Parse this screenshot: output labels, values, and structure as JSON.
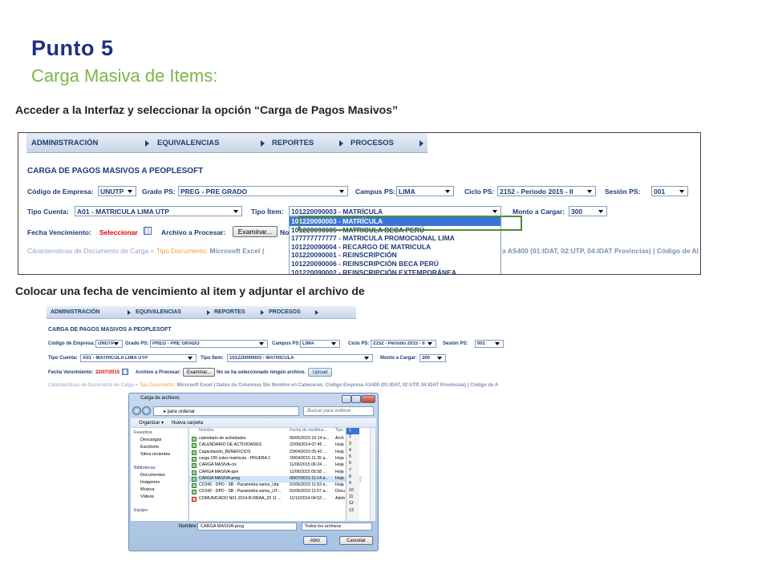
{
  "slide": {
    "title": "Punto 5",
    "subtitle": "Carga Masiva de Items:",
    "instruction_1": "Acceder a la Interfaz y seleccionar la opción “Carga de Pagos Masivos”",
    "instruction_2": "Colocar una fecha de vencimiento al item y adjuntar el archivo de"
  },
  "app": {
    "menu": [
      "ADMINISTRACIÓN",
      "EQUIVALENCIAS",
      "REPORTES",
      "PROCESOS"
    ],
    "form_title": "CARGA DE PAGOS MASIVOS A PEOPLESOFT",
    "labels": {
      "codigo_empresa": "Código de Empresa:",
      "grado_ps": "Grado PS:",
      "campus_ps": "Campus PS:",
      "ciclo_ps": "Ciclo PS:",
      "sesion_ps": "Sesión PS:",
      "tipo_cuenta": "Tipo Cuenta:",
      "tipo_item": "Tipo Ítem:",
      "monto_cargar": "Monto a Cargar:",
      "fecha_vencimiento": "Fecha Vencimiento:",
      "archivo_procesar": "Archivo a Procesar:"
    },
    "values": {
      "codigo_empresa": "UNUTP",
      "grado_ps": "PREG - PRE GRADO",
      "campus_ps": "LIMA",
      "ciclo_ps": "2152 - Periodo 2015 - II",
      "sesion_ps": "001",
      "tipo_cuenta": "A01 - MATRICULA LIMA UTP",
      "tipo_item": "101220090003 - MATRÍCULA",
      "monto_cargar": "300"
    },
    "fecha_select_text": "Seleccionar",
    "examinar_button": "Examinar...",
    "no_file_text": "No se ha seleccionado ningún archivo.",
    "upload_button": "Upload",
    "no_prefix": "No",
    "caracteristicas_1": {
      "prefix": "Cáracteristicas de Documento de Carga = ",
      "tipo_documento": "Tipo Documento:",
      "tipo_value": "Microsoft Excel (",
      "tail": "a AS400 (01:IDAT, 02:UTP, 04:IDAT Provincias) | Código de Al"
    },
    "caracteristicas_2": {
      "prefix": "Cáracteristicas de Documento de Carga = ",
      "tipo_documento": "Tipo Documento:",
      "tipo_value": "Microsoft Excel",
      "tail": " | Datos de Columnas Sin Nombre en Cabeceras: Código Empresa AS400 (01:IDAT, 02:UTP, 04:IDAT Provincias) | Código de A"
    },
    "fecha_value": "22/07/2015",
    "dropdown_options": [
      "101220090003 - MATRÍCULA",
      "101220090005 - MATRICULA BECA PERÚ",
      "177777777777 - MATRICULA PROMOCIONAL LIMA",
      "101220090004 - RECARGO DE MATRICULA",
      "101220090001 - REINSCRIPCIÓN",
      "101220090006 - REINSCRIPCIÓN BECA PERÚ",
      "101220090002 - REINSCRIPCIÓN EXTEMPORÁNEA"
    ]
  },
  "dialog": {
    "title": "Carga de archivos",
    "address": "▸ para ordenar",
    "search_placeholder": "Buscar para ordenar",
    "organize": "Organizar ▾",
    "new_folder": "Nueva carpeta",
    "nav": {
      "favoritos": "Favoritos",
      "descargas": "Descargas",
      "escritorio": "Escritorio",
      "sitios": "Sitios recientes",
      "bibliotecas": "Bibliotecas",
      "documentos": "Documentos",
      "imagenes": "Imágenes",
      "musica": "Música",
      "videos": "Vídeos",
      "equipo": "Equipo"
    },
    "columns": {
      "name": "Nombre",
      "date": "Fecha de modifica...",
      "type": "Tipo"
    },
    "files": [
      {
        "name": "calendario de actividades",
        "date": "06/05/2015 10:14 a...",
        "type": "Arch"
      },
      {
        "name": "CALENDARIO DE ACTIVIDADES",
        "date": "22/09/2014 07:45 ...",
        "type": "Hoja"
      },
      {
        "name": "Capacitación_BENEFICIOS",
        "date": "23/04/2015 05:42 ...",
        "type": "Hoja"
      },
      {
        "name": "carga 195 soles matricula - PRUEBA 1",
        "date": "29/04/2015 11:35 a...",
        "type": "Hoja"
      },
      {
        "name": "CARGA MASIVA-cix",
        "date": "11/06/2015 06:24 ...",
        "type": "Hoja"
      },
      {
        "name": "CARGA MASIVA-ppe",
        "date": "11/06/2015 05:58 ...",
        "type": "Hoja"
      },
      {
        "name": "CARGA MASIVA-preg",
        "date": "06/07/2015 11:14 a...",
        "type": "Hoja"
      },
      {
        "name": "CC042 - DPD - SB - Parametria varios_Utp",
        "date": "01/06/2015 11:53 a...",
        "type": "Hoja"
      },
      {
        "name": "CC042 - DPD - SB - Parametria varios_UT...",
        "date": "01/06/2015 11:57 a...",
        "type": "Docu"
      },
      {
        "name": "COMUNICADO N01-2014-B-RRAA_20 11 ...",
        "date": "11/12/2014 04:53 ...",
        "type": "Adob"
      }
    ],
    "row_numbers": [
      "1",
      "2",
      "3",
      "4",
      "5",
      "6",
      "7",
      "8",
      "9",
      "10",
      "11",
      "12",
      "13"
    ],
    "filename_label": "Nombre:",
    "filename_value": "CARGA MASIVA-preg",
    "filetype_value": "Todos los archivos",
    "open_button": "Abrir",
    "cancel_button": "Cancelar"
  },
  "colors": {
    "title": "#1f2e86",
    "subtitle": "#7ab648",
    "form_text": "#1e3a7a",
    "highlight": "#3874d8",
    "annotation_box": "#4d8b3a",
    "error": "#e00000"
  }
}
